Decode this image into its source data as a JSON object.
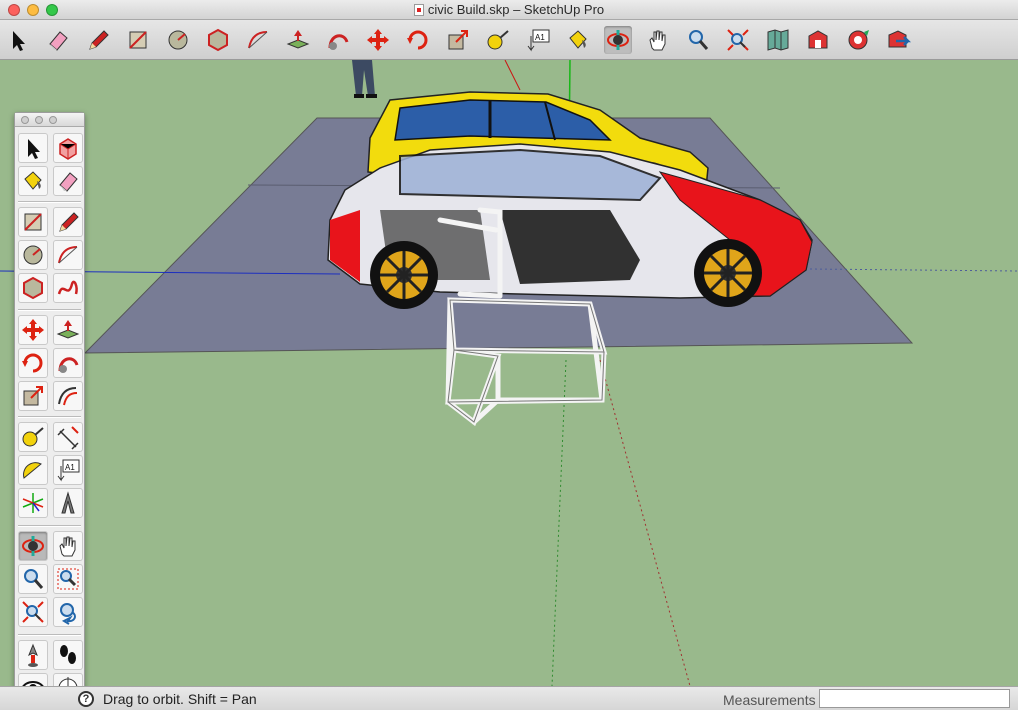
{
  "window": {
    "title": "civic Build.skp – SketchUp Pro",
    "traffic_lights": [
      "close",
      "minimize",
      "zoom"
    ]
  },
  "colors": {
    "close": "#fc615d",
    "minimize": "#fdbc40",
    "zoom": "#34c84a",
    "ground": "#99b98c",
    "plane": "#787c95",
    "car_yellow": "#f2dc0d",
    "car_red": "#e8141b",
    "frame_white": "#f4f4f4"
  },
  "toolbar": {
    "items": [
      {
        "name": "select-tool",
        "icon": "arrow-cursor-icon"
      },
      {
        "name": "eraser-tool",
        "icon": "eraser-icon"
      },
      {
        "name": "pencil-tool",
        "icon": "pencil-icon"
      },
      {
        "name": "rectangle-tool",
        "icon": "rectangle-icon"
      },
      {
        "name": "circle-tool",
        "icon": "circle-icon"
      },
      {
        "name": "polygon-tool",
        "icon": "polygon-icon"
      },
      {
        "name": "arc-tool",
        "icon": "arc-icon"
      },
      {
        "name": "push-pull-tool",
        "icon": "push-pull-icon"
      },
      {
        "name": "follow-me-tool",
        "icon": "follow-me-icon"
      },
      {
        "name": "move-tool",
        "icon": "move-icon"
      },
      {
        "name": "rotate-tool",
        "icon": "rotate-icon"
      },
      {
        "name": "scale-tool",
        "icon": "scale-icon"
      },
      {
        "name": "tape-measure-tool",
        "icon": "tape-measure-icon"
      },
      {
        "name": "text-tool",
        "icon": "text-label-icon",
        "label": "A1"
      },
      {
        "name": "paint-bucket-tool",
        "icon": "paint-bucket-icon"
      },
      {
        "name": "orbit-tool",
        "icon": "orbit-icon",
        "active": true
      },
      {
        "name": "pan-tool",
        "icon": "pan-hand-icon"
      },
      {
        "name": "zoom-tool",
        "icon": "zoom-icon"
      },
      {
        "name": "zoom-extents-tool",
        "icon": "zoom-extents-icon"
      },
      {
        "name": "get-models-tool",
        "icon": "map-icon"
      },
      {
        "name": "3d-warehouse-tool",
        "icon": "warehouse-icon"
      },
      {
        "name": "extension-warehouse-tool",
        "icon": "extension-icon"
      },
      {
        "name": "share-model-tool",
        "icon": "share-model-icon"
      }
    ]
  },
  "palette": {
    "text_tool_label": "A1",
    "items": [
      {
        "name": "select",
        "icon": "arrow-cursor-icon"
      },
      {
        "name": "make-component",
        "icon": "component-icon"
      },
      {
        "name": "paint-bucket",
        "icon": "paint-bucket-icon"
      },
      {
        "name": "eraser",
        "icon": "eraser-icon"
      },
      {
        "name": "rectangle",
        "icon": "rectangle-icon"
      },
      {
        "name": "pencil",
        "icon": "pencil-icon"
      },
      {
        "name": "circle",
        "icon": "circle-icon"
      },
      {
        "name": "arc",
        "icon": "arc-icon"
      },
      {
        "name": "polygon",
        "icon": "polygon-icon"
      },
      {
        "name": "freehand",
        "icon": "freehand-icon"
      },
      {
        "name": "move",
        "icon": "move-icon"
      },
      {
        "name": "push-pull",
        "icon": "push-pull-icon"
      },
      {
        "name": "rotate",
        "icon": "rotate-icon"
      },
      {
        "name": "follow-me",
        "icon": "follow-me-icon"
      },
      {
        "name": "scale",
        "icon": "scale-icon"
      },
      {
        "name": "offset",
        "icon": "offset-icon"
      },
      {
        "name": "tape-measure",
        "icon": "tape-measure-icon"
      },
      {
        "name": "dimension",
        "icon": "dimension-icon"
      },
      {
        "name": "protractor",
        "icon": "protractor-icon"
      },
      {
        "name": "text",
        "icon": "text-label-icon"
      },
      {
        "name": "axes",
        "icon": "axes-icon"
      },
      {
        "name": "3d-text",
        "icon": "3d-text-icon"
      },
      {
        "name": "orbit",
        "icon": "orbit-icon",
        "active": true
      },
      {
        "name": "pan",
        "icon": "pan-hand-icon"
      },
      {
        "name": "zoom",
        "icon": "zoom-icon"
      },
      {
        "name": "zoom-window",
        "icon": "zoom-window-icon"
      },
      {
        "name": "zoom-extents",
        "icon": "zoom-extents-icon"
      },
      {
        "name": "previous-view",
        "icon": "previous-view-icon"
      },
      {
        "name": "position-camera",
        "icon": "position-camera-icon"
      },
      {
        "name": "walk",
        "icon": "footprints-icon"
      },
      {
        "name": "look-around",
        "icon": "eye-icon"
      },
      {
        "name": "section-plane",
        "icon": "section-plane-icon"
      }
    ]
  },
  "statusbar": {
    "hint": "Drag to orbit.  Shift = Pan",
    "help_icon": "?",
    "measurements_label": "Measurements",
    "measurements_value": ""
  }
}
